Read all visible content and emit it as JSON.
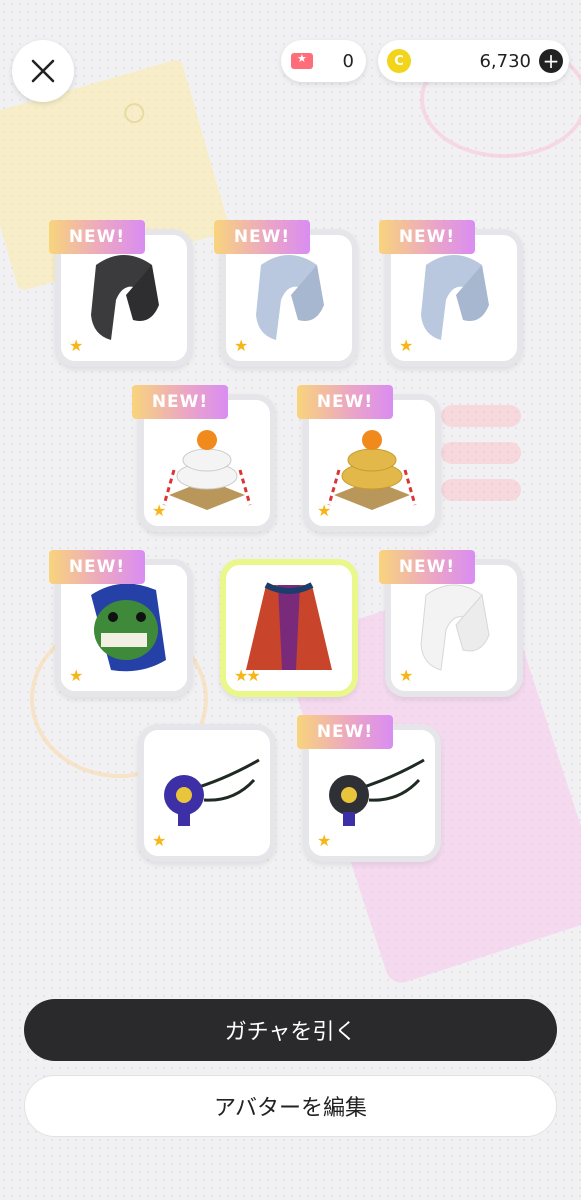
{
  "header": {
    "ticket_count": "0",
    "coin_symbol": "C",
    "coin_balance": "6,730",
    "plus_symbol": "+"
  },
  "items": [
    {
      "name": "Black fur scarf",
      "new": true,
      "stars": 1,
      "new_label": "NEW!",
      "stars_text": "★"
    },
    {
      "name": "Light blue fur scarf",
      "new": true,
      "stars": 1,
      "new_label": "NEW!",
      "stars_text": "★"
    },
    {
      "name": "Light blue fur scarf",
      "new": true,
      "stars": 1,
      "new_label": "NEW!",
      "stars_text": "★"
    },
    {
      "name": "Kagami mochi with white base",
      "new": true,
      "stars": 1,
      "new_label": "NEW!",
      "stars_text": "★"
    },
    {
      "name": "Kagami mochi with gold base",
      "new": true,
      "stars": 1,
      "new_label": "NEW!",
      "stars_text": "★"
    },
    {
      "name": "Green oni mask",
      "new": true,
      "stars": 1,
      "new_label": "NEW!",
      "stars_text": "★"
    },
    {
      "name": "Red patterned coat",
      "new": false,
      "stars": 2,
      "selected": true,
      "stars_text": "★★"
    },
    {
      "name": "White fur scarf",
      "new": true,
      "stars": 1,
      "new_label": "NEW!",
      "stars_text": "★"
    },
    {
      "name": "Purple flower choker",
      "new": false,
      "stars": 1,
      "stars_text": "★"
    },
    {
      "name": "Black flower choker",
      "new": true,
      "stars": 1,
      "new_label": "NEW!",
      "stars_text": "★"
    }
  ],
  "buttons": {
    "draw_gacha": "ガチャを引く",
    "edit_avatar": "アバターを編集"
  },
  "colors": {
    "primary_button": "#2a2a2c",
    "star": "#f6b618",
    "selected_border": "#eaf78a",
    "coin": "#f2d51a",
    "ticket": "#ff6d7a"
  }
}
